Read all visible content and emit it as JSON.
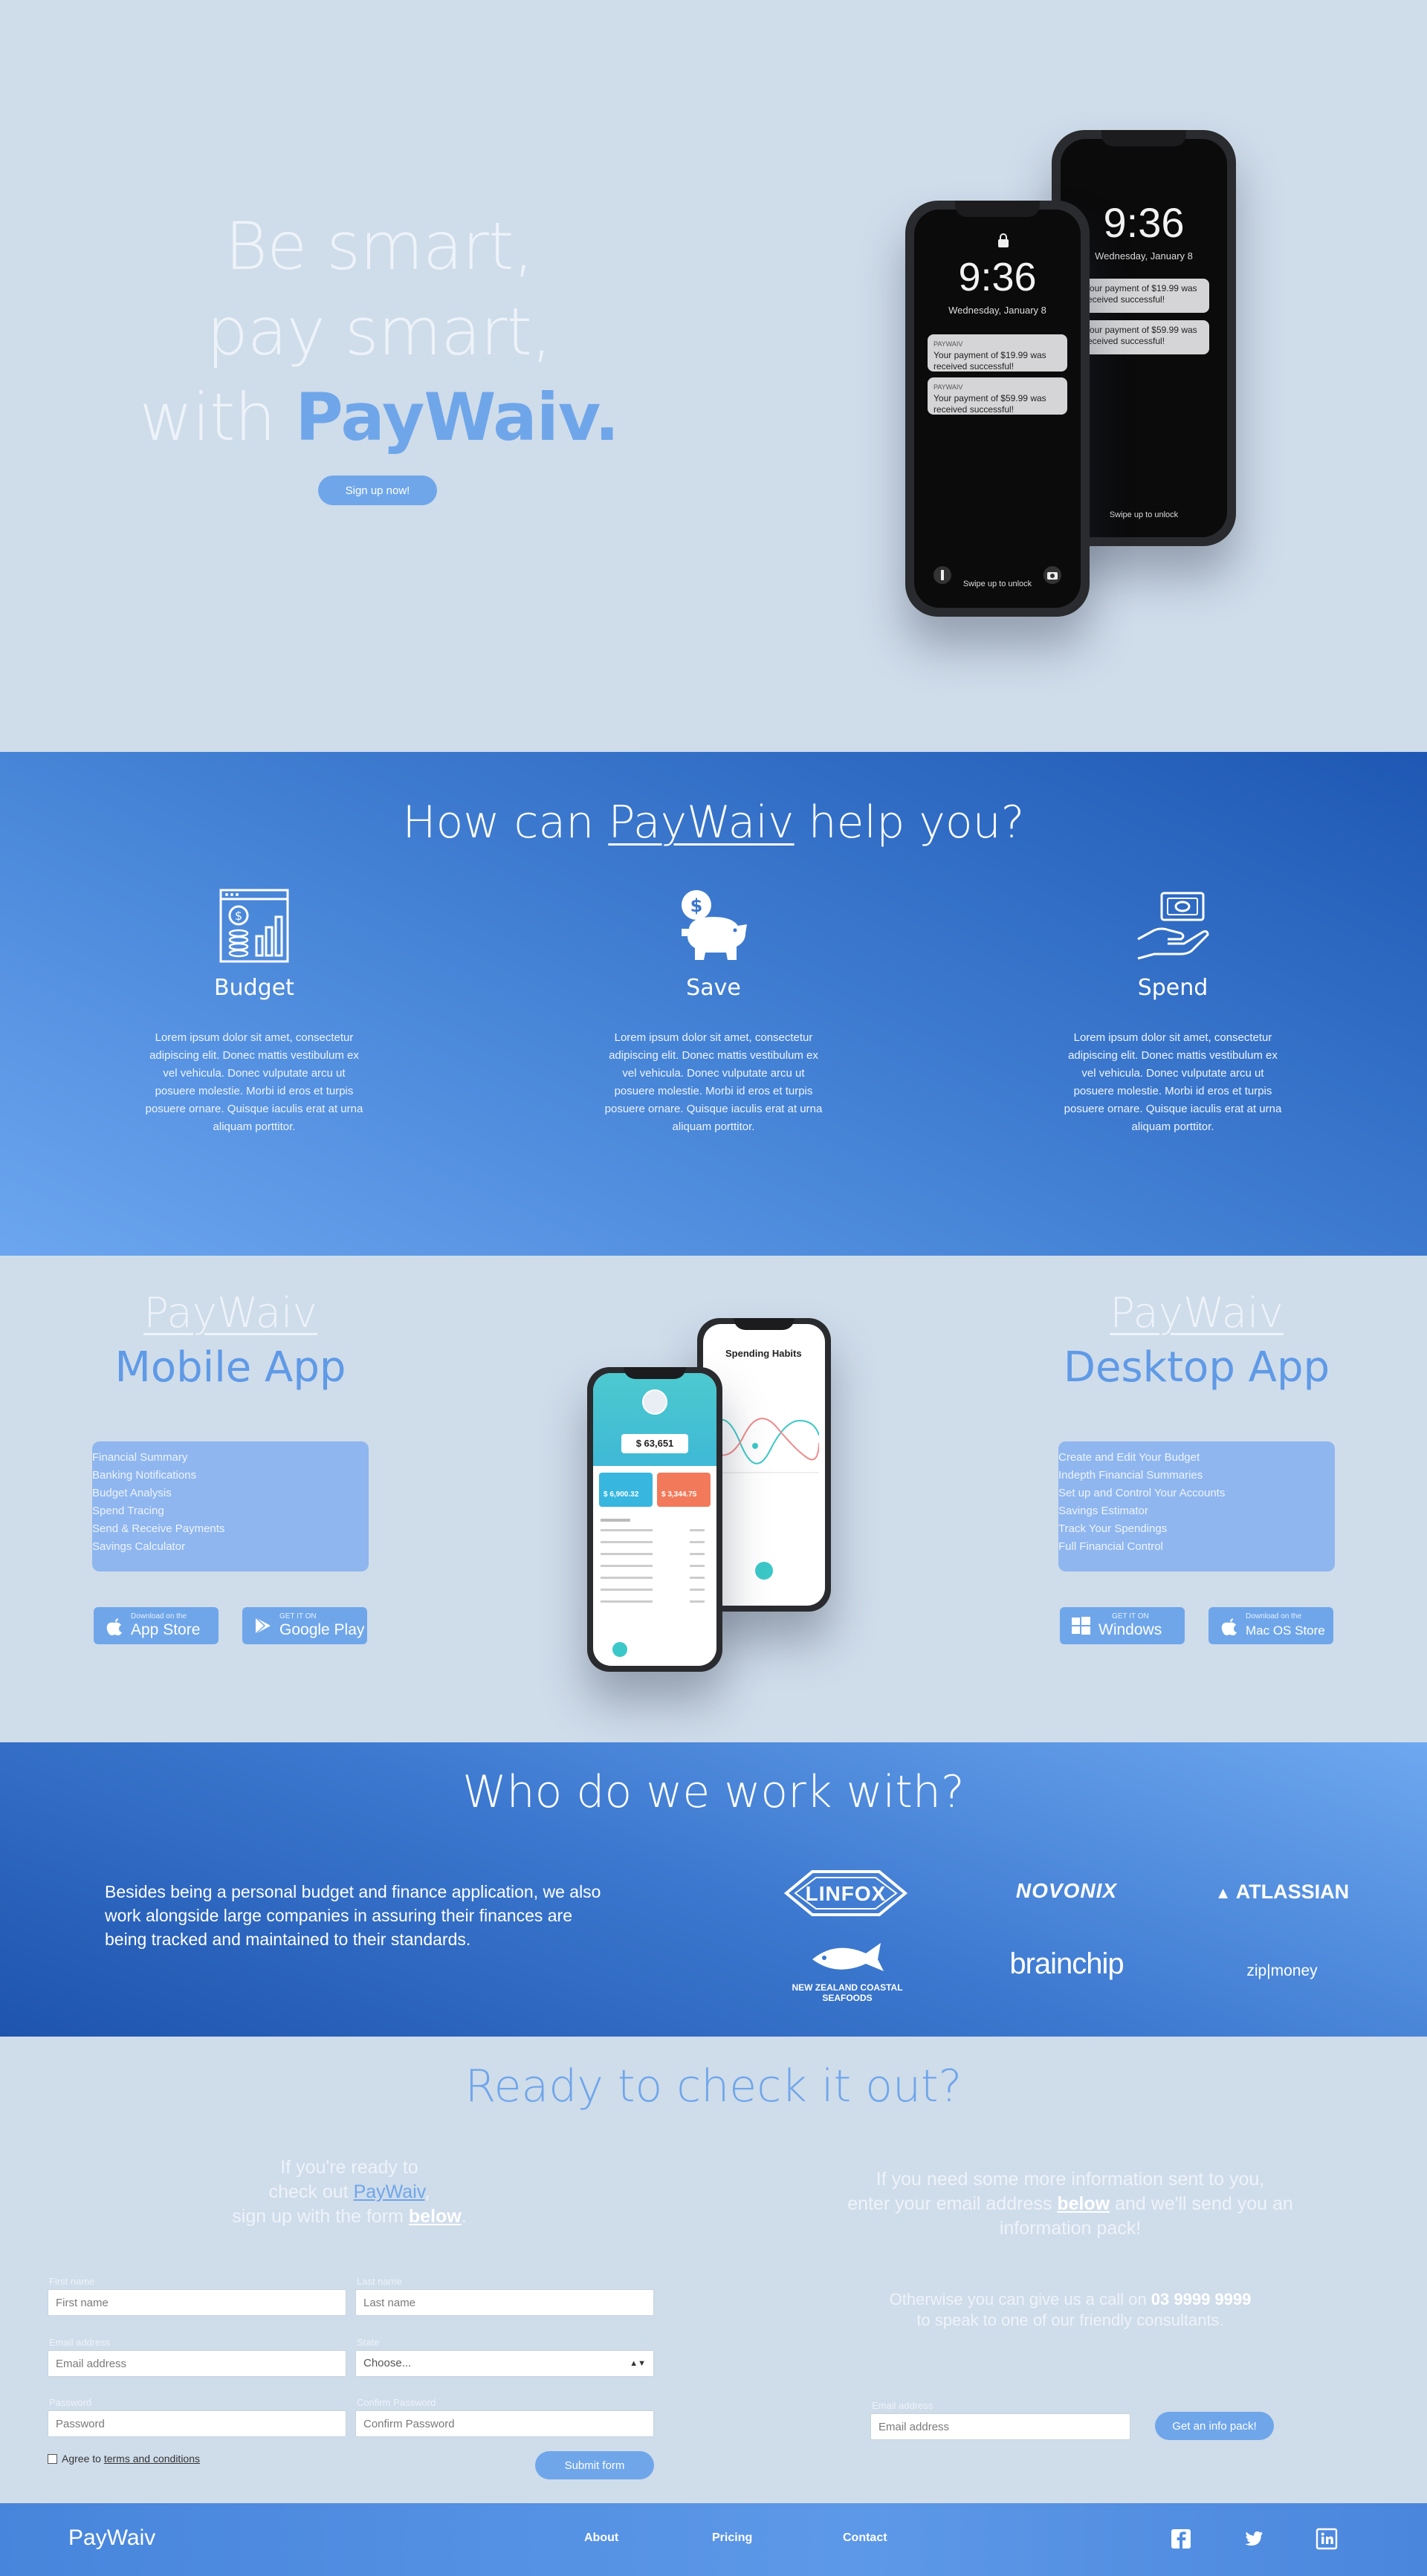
{
  "hero": {
    "line1": "Be smart,",
    "line2": "pay smart,",
    "line3_prefix": "with ",
    "line3_brand": "PayWaiv.",
    "cta": "Sign up now!",
    "phone_back": {
      "time": "9:36",
      "date": "Wednesday, January 8",
      "notif1": "Your payment of $19.99 was received successful!",
      "notif2": "Your payment of $59.99 was received successful!",
      "swipe": "Swipe up to unlock"
    },
    "phone_front": {
      "time": "9:36",
      "date": "Wednesday, January 8",
      "notif_app": "PAYWAIV",
      "notif_ago": "1m ago",
      "notif1": "Your payment of $19.99 was received successful!",
      "notif2": "Your payment of $59.99 was received successful!",
      "swipe": "Swipe up to unlock"
    }
  },
  "help": {
    "title_pre": "How can ",
    "title_brand": "PayWaiv",
    "title_post": " help you?",
    "features": [
      {
        "icon": "budget-report-icon",
        "title": "Budget",
        "text": "Lorem ipsum dolor sit amet, consectetur adipiscing elit. Donec mattis vestibulum ex vel vehicula. Donec vulputate arcu ut posuere molestie. Morbi id eros et turpis posuere ornare. Quisque iaculis erat at urna aliquam porttitor."
      },
      {
        "icon": "piggy-bank-icon",
        "title": "Save",
        "text": "Lorem ipsum dolor sit amet, consectetur adipiscing elit. Donec mattis vestibulum ex vel vehicula. Donec vulputate arcu ut posuere molestie. Morbi id eros et turpis posuere ornare. Quisque iaculis erat at urna aliquam porttitor."
      },
      {
        "icon": "hand-money-icon",
        "title": "Spend",
        "text": "Lorem ipsum dolor sit amet, consectetur adipiscing elit. Donec mattis vestibulum ex vel vehicula. Donec vulputate arcu ut posuere molestie. Morbi id eros et turpis posuere ornare. Quisque iaculis erat at urna aliquam porttitor."
      }
    ]
  },
  "apps": {
    "mobile": {
      "brand": "PayWaiv",
      "kind": "Mobile App",
      "features": [
        "Financial Summary",
        "Banking Notifications",
        "Budget Analysis",
        "Spend Tracing",
        "Send & Receive Payments",
        "Savings Calculator"
      ],
      "store1_small": "Download on the",
      "store1_big": "App Store",
      "store2_small": "GET IT ON",
      "store2_big": "Google Play"
    },
    "desktop": {
      "brand": "PayWaiv",
      "kind": "Desktop App",
      "features": [
        "Create and Edit Your Budget",
        "Indepth Financial Summaries",
        "Set up and Control Your Accounts",
        "Savings Estimator",
        "Track Your Spendings",
        "Full Financial Control"
      ],
      "store1_small": "GET IT ON",
      "store1_big": "Windows",
      "store2_small": "Download on the",
      "store2_big": "Mac OS Store"
    },
    "mock": {
      "title": "Spending Habits",
      "balance": "$ 63,651",
      "card1": "$ 6,900.32",
      "card2": "$ 3,344.75"
    }
  },
  "partners": {
    "title": "Who do we work with?",
    "lead": "Besides being a personal budget and finance application, we also work alongside large companies in assuring their finances are being tracked and maintained to their standards.",
    "logos": [
      "LINFOX",
      "NOVONIX",
      "ATLASSIAN",
      "NEW ZEALAND COASTAL SEAFOODS",
      "brainchip",
      "zip|money"
    ]
  },
  "contact": {
    "title": "Ready to check it out?",
    "left_1": "If you're ready to",
    "left_2a": "check out ",
    "left_2_brand": "PayWaiv",
    "left_2b": ",",
    "left_3a": "sign up with the form ",
    "left_3_link": "below",
    "left_3b": ".",
    "right_1": "If you need some more information sent to you,",
    "right_2a": "enter your email address ",
    "right_2_link": "below",
    "right_2b": " and we'll send you an",
    "right_3": "information pack!",
    "right_4a": "Otherwise you can give us a call on ",
    "right_4_phone": "03 9999 9999",
    "right_5": "to speak to one of our friendly consultants.",
    "form": {
      "first_label": "First name",
      "first_ph": "First name",
      "last_label": "Last name",
      "last_ph": "Last name",
      "email_label": "Email address",
      "email_ph": "Email address",
      "state_label": "State",
      "state_value": "Choose...",
      "pass_label": "Password",
      "pass_ph": "Password",
      "confirm_label": "Confirm Password",
      "confirm_ph": "Confirm Password",
      "agree_pre": "Agree to ",
      "agree_link": "terms and conditions",
      "submit": "Submit form"
    },
    "info": {
      "email_label": "Email address",
      "email_ph": "Email address",
      "button": "Get an info pack!"
    }
  },
  "footer": {
    "logo": "PayWaiv",
    "links": [
      "About",
      "Pricing",
      "Contact"
    ],
    "social": [
      "facebook-icon",
      "twitter-icon",
      "linkedin-icon"
    ]
  },
  "colors": {
    "accent": "#6fa6ea",
    "page_bg": "#cfdcea",
    "dark_blue": "#1e58b4"
  }
}
